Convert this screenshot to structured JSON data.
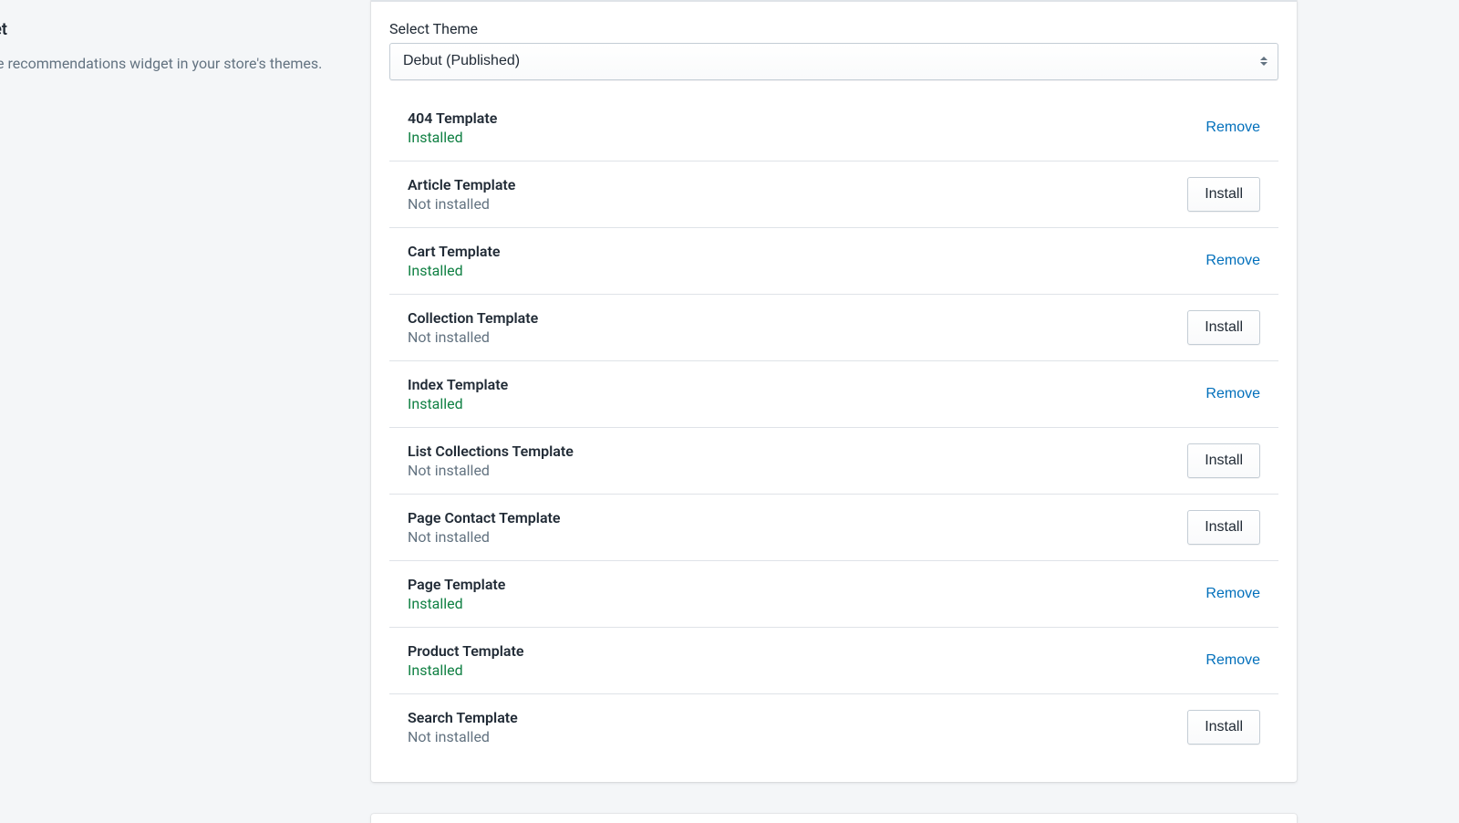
{
  "sidebar": {
    "title_fragment": "get",
    "desc_fragment": "the recommendations widget in your store's themes."
  },
  "main": {
    "select_label": "Select Theme",
    "select_value": "Debut (Published)",
    "status_installed": "Installed",
    "status_not_installed": "Not installed",
    "install_label": "Install",
    "remove_label": "Remove",
    "templates": [
      {
        "name": "404 Template",
        "installed": true
      },
      {
        "name": "Article Template",
        "installed": false
      },
      {
        "name": "Cart Template",
        "installed": true
      },
      {
        "name": "Collection Template",
        "installed": false
      },
      {
        "name": "Index Template",
        "installed": true
      },
      {
        "name": "List Collections Template",
        "installed": false
      },
      {
        "name": "Page Contact Template",
        "installed": false
      },
      {
        "name": "Page Template",
        "installed": true
      },
      {
        "name": "Product Template",
        "installed": true
      },
      {
        "name": "Search Template",
        "installed": false
      }
    ]
  }
}
